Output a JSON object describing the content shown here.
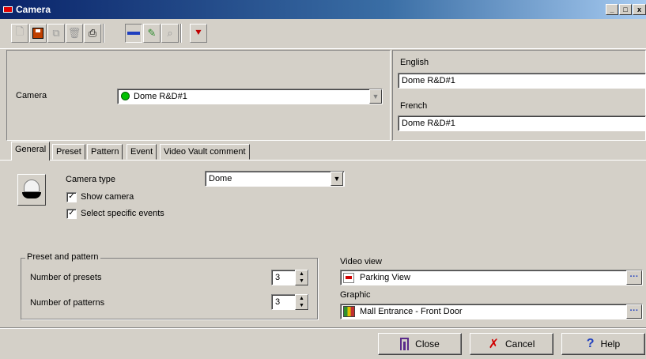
{
  "window": {
    "title": "Camera",
    "controls": [
      "_",
      "□",
      "x"
    ]
  },
  "toolbar": {
    "icons": [
      "new-icon",
      "save-icon",
      "copy-icon",
      "delete-icon",
      "print-icon",
      "minus-icon",
      "link-icon",
      "binoculars-icon",
      "pin-icon"
    ]
  },
  "camera": {
    "label": "Camera",
    "value": "Dome R&D#1",
    "status_color": "#00c000"
  },
  "languages": {
    "english_label": "English",
    "english_value": "Dome R&D#1",
    "french_label": "French",
    "french_value": "Dome R&D#1"
  },
  "tabs": [
    {
      "label": "General",
      "selected": true
    },
    {
      "label": "Preset",
      "selected": false
    },
    {
      "label": "Pattern",
      "selected": false
    },
    {
      "label": "Event",
      "selected": false
    },
    {
      "label": "Video Vault comment",
      "selected": false
    }
  ],
  "general": {
    "camera_type_label": "Camera type",
    "camera_type_value": "Dome",
    "show_camera_label": "Show camera",
    "show_camera_checked": true,
    "select_events_label": "Select specific events",
    "select_events_checked": true
  },
  "preset_pattern": {
    "group_title": "Preset and pattern",
    "presets_label": "Number of presets",
    "presets_value": "3",
    "patterns_label": "Number of patterns",
    "patterns_value": "3"
  },
  "video_view": {
    "label": "Video view",
    "value": "Parking View"
  },
  "graphic": {
    "label": "Graphic",
    "value": "Mall Entrance - Front Door"
  },
  "buttons": {
    "close_label": "Close",
    "cancel_label": "Cancel",
    "help_label": "Help"
  }
}
